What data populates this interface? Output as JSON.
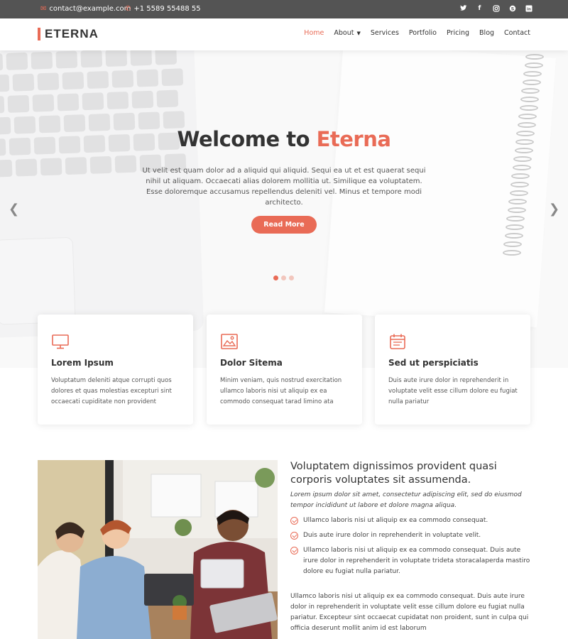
{
  "topbar": {
    "email": "contact@example.com",
    "phone": "+1 5589 55488 55",
    "socials": [
      "twitter-icon",
      "facebook-icon",
      "instagram-icon",
      "skype-icon",
      "linkedin-icon"
    ]
  },
  "header": {
    "logo": "ETERNA",
    "nav": [
      {
        "label": "Home",
        "active": true
      },
      {
        "label": "About",
        "dropdown": true
      },
      {
        "label": "Services"
      },
      {
        "label": "Portfolio"
      },
      {
        "label": "Pricing"
      },
      {
        "label": "Blog"
      },
      {
        "label": "Contact"
      }
    ]
  },
  "hero": {
    "title_prefix": "Welcome to ",
    "title_accent": "Eterna",
    "description": "Ut velit est quam dolor ad a aliquid qui aliquid. Sequi ea ut et est quaerat sequi nihil ut aliquam. Occaecati alias dolorem mollitia ut. Similique ea voluptatem. Esse doloremque accusamus repellendus deleniti vel. Minus et tempore modi architecto.",
    "button": "Read More",
    "slides": 3,
    "active_slide": 1
  },
  "features": [
    {
      "icon": "monitor-icon",
      "title": "Lorem Ipsum",
      "text": "Voluptatum deleniti atque corrupti quos dolores et quas molestias excepturi sint occaecati cupiditate non provident"
    },
    {
      "icon": "image-icon",
      "title": "Dolor Sitema",
      "text": "Minim veniam, quis nostrud exercitation ullamco laboris nisi ut aliquip ex ea commodo consequat tarad limino ata"
    },
    {
      "icon": "calendar-icon",
      "title": "Sed ut perspiciatis",
      "text": "Duis aute irure dolor in reprehenderit in voluptate velit esse cillum dolore eu fugiat nulla pariatur"
    }
  ],
  "about": {
    "heading": "Voluptatem dignissimos provident quasi corporis voluptates sit assumenda.",
    "lead": "Lorem ipsum dolor sit amet, consectetur adipiscing elit, sed do eiusmod tempor incididunt ut labore et dolore magna aliqua.",
    "items": [
      "Ullamco laboris nisi ut aliquip ex ea commodo consequat.",
      "Duis aute irure dolor in reprehenderit in voluptate velit.",
      "Ullamco laboris nisi ut aliquip ex ea commodo consequat. Duis aute irure dolor in reprehenderit in voluptate trideta storacalaperda mastiro dolore eu fugiat nulla pariatur."
    ],
    "paragraph": "Ullamco laboris nisi ut aliquip ex ea commodo consequat. Duis aute irure dolor in reprehenderit in voluptate velit esse cillum dolore eu fugiat nulla pariatur. Excepteur sint occaecat cupidatat non proident, sunt in culpa qui officia deserunt mollit anim id est laborum"
  },
  "colors": {
    "accent": "#e96b56",
    "topbar": "#545454",
    "text": "#333333"
  }
}
